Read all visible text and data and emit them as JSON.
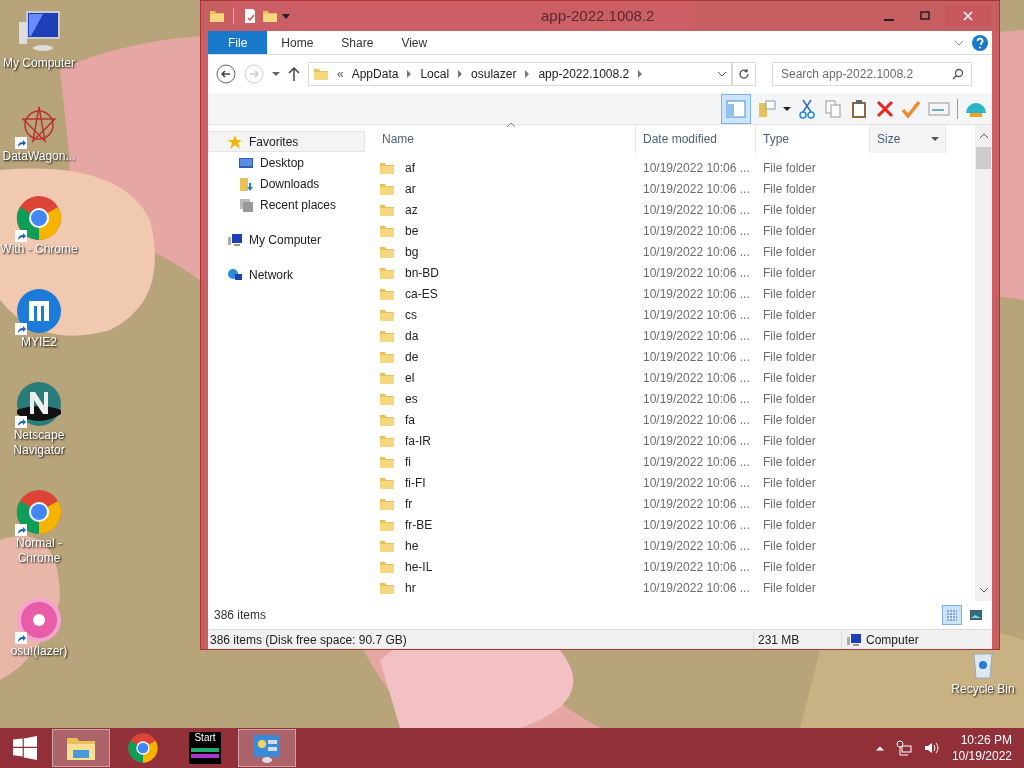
{
  "desktop_icons": [
    {
      "label": "My Computer",
      "kind": "computer",
      "shortcut": false
    },
    {
      "label": "DataWagon...",
      "kind": "star",
      "shortcut": true
    },
    {
      "label": "With - Chrome",
      "kind": "chrome",
      "shortcut": true
    },
    {
      "label": "MYIE2",
      "kind": "myie",
      "shortcut": true
    },
    {
      "label": "Netscape Navigator",
      "kind": "netscape",
      "shortcut": true
    },
    {
      "label": "Normal - Chrome",
      "kind": "chrome",
      "shortcut": true
    },
    {
      "label": "osu!(lazer)",
      "kind": "osu",
      "shortcut": true
    }
  ],
  "recycle_bin": {
    "label": "Recycle Bin"
  },
  "window": {
    "title": "app-2022.1008.2",
    "ribbon_tabs": [
      {
        "label": "File",
        "selected": true
      },
      {
        "label": "Home",
        "selected": false
      },
      {
        "label": "Share",
        "selected": false
      },
      {
        "label": "View",
        "selected": false
      }
    ],
    "address": {
      "prefix": "«",
      "crumbs": [
        "AppData",
        "Local",
        "osulazer",
        "app-2022.1008.2"
      ]
    },
    "search": {
      "placeholder": "Search app-2022.1008.2"
    },
    "toolbar": {
      "preview_pane_on": true
    },
    "nav": [
      {
        "label": "Favorites",
        "kind": "star",
        "selected": true,
        "children": [
          {
            "label": "Desktop",
            "kind": "desktop"
          },
          {
            "label": "Downloads",
            "kind": "downloads"
          },
          {
            "label": "Recent places",
            "kind": "recent"
          }
        ]
      },
      {
        "label": "My Computer",
        "kind": "computer",
        "selected": false
      },
      {
        "label": "Network",
        "kind": "network",
        "selected": false
      }
    ],
    "columns": [
      {
        "label": "Name",
        "sorted": true
      },
      {
        "label": "Date modified",
        "sorted": false
      },
      {
        "label": "Type",
        "sorted": false
      },
      {
        "label": "Size",
        "sorted": false
      }
    ],
    "rows": [
      {
        "name": "af",
        "date": "10/19/2022 10:06 ...",
        "type": "File folder"
      },
      {
        "name": "ar",
        "date": "10/19/2022 10:06 ...",
        "type": "File folder"
      },
      {
        "name": "az",
        "date": "10/19/2022 10:06 ...",
        "type": "File folder"
      },
      {
        "name": "be",
        "date": "10/19/2022 10:06 ...",
        "type": "File folder"
      },
      {
        "name": "bg",
        "date": "10/19/2022 10:06 ...",
        "type": "File folder"
      },
      {
        "name": "bn-BD",
        "date": "10/19/2022 10:06 ...",
        "type": "File folder"
      },
      {
        "name": "ca-ES",
        "date": "10/19/2022 10:06 ...",
        "type": "File folder"
      },
      {
        "name": "cs",
        "date": "10/19/2022 10:06 ...",
        "type": "File folder"
      },
      {
        "name": "da",
        "date": "10/19/2022 10:06 ...",
        "type": "File folder"
      },
      {
        "name": "de",
        "date": "10/19/2022 10:06 ...",
        "type": "File folder"
      },
      {
        "name": "el",
        "date": "10/19/2022 10:06 ...",
        "type": "File folder"
      },
      {
        "name": "es",
        "date": "10/19/2022 10:06 ...",
        "type": "File folder"
      },
      {
        "name": "fa",
        "date": "10/19/2022 10:06 ...",
        "type": "File folder"
      },
      {
        "name": "fa-IR",
        "date": "10/19/2022 10:06 ...",
        "type": "File folder"
      },
      {
        "name": "fi",
        "date": "10/19/2022 10:06 ...",
        "type": "File folder"
      },
      {
        "name": "fi-FI",
        "date": "10/19/2022 10:06 ...",
        "type": "File folder"
      },
      {
        "name": "fr",
        "date": "10/19/2022 10:06 ...",
        "type": "File folder"
      },
      {
        "name": "fr-BE",
        "date": "10/19/2022 10:06 ...",
        "type": "File folder"
      },
      {
        "name": "he",
        "date": "10/19/2022 10:06 ...",
        "type": "File folder"
      },
      {
        "name": "he-IL",
        "date": "10/19/2022 10:06 ...",
        "type": "File folder"
      },
      {
        "name": "hr",
        "date": "10/19/2022 10:06 ...",
        "type": "File folder"
      }
    ],
    "details_view": true,
    "item_count": "386 items",
    "status_bar": {
      "summary": "386 items (Disk free space: 90.7 GB)",
      "size": "231 MB",
      "location": "Computer"
    }
  },
  "taskbar": {
    "items": [
      {
        "kind": "explorer",
        "selected": true
      },
      {
        "kind": "chrome",
        "selected": false
      },
      {
        "kind": "start-app",
        "label": "Start",
        "selected": false
      },
      {
        "kind": "control-panel",
        "selected": true
      }
    ],
    "clock": {
      "time": "10:26 PM",
      "date": "10/19/2022"
    }
  }
}
